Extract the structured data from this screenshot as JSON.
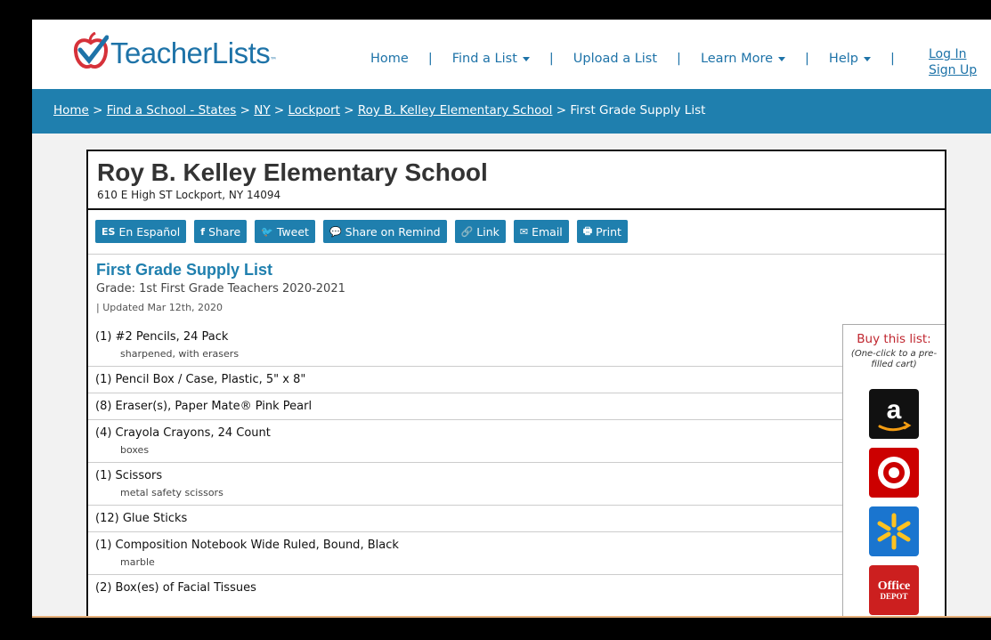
{
  "header": {
    "logo_text": "TeacherLists",
    "logo_tm": "™",
    "nav": [
      {
        "label": "Home",
        "caret": false
      },
      {
        "label": "Find a List",
        "caret": true
      },
      {
        "label": "Upload a List",
        "caret": false
      },
      {
        "label": "Learn More",
        "caret": true
      },
      {
        "label": "Help",
        "caret": true
      }
    ],
    "login": "Log In",
    "signup": "Sign Up"
  },
  "breadcrumb": {
    "items": [
      "Home",
      "Find a School - States",
      "NY",
      "Lockport",
      "Roy B. Kelley Elementary School"
    ],
    "separator": ">",
    "current": "First Grade Supply List"
  },
  "school": {
    "name": "Roy B. Kelley Elementary School",
    "address": "610 E High ST Lockport, NY 14094"
  },
  "actions": [
    {
      "icon": "ES",
      "label": "En Español",
      "name": "espanol-button"
    },
    {
      "icon": "f",
      "label": "Share",
      "name": "share-button"
    },
    {
      "icon": "🐦",
      "label": "Tweet",
      "name": "tweet-button"
    },
    {
      "icon": "💬",
      "label": "Share on Remind",
      "name": "remind-button"
    },
    {
      "icon": "🔗",
      "label": "Link",
      "name": "link-button"
    },
    {
      "icon": "✉",
      "label": "Email",
      "name": "email-button"
    },
    {
      "icon": "🖶",
      "label": "Print",
      "name": "print-button"
    }
  ],
  "list": {
    "title": "First Grade Supply List",
    "meta": "Grade: 1st  First Grade Teachers  2020-2021",
    "updated": "| Updated Mar 12th, 2020",
    "items": [
      {
        "name": "(1)  #2 Pencils, 24 Pack",
        "note": "sharpened, with erasers"
      },
      {
        "name": "(1)  Pencil Box / Case, Plastic, 5\" x 8\"",
        "note": ""
      },
      {
        "name": "(8)  Eraser(s), Paper Mate® Pink Pearl",
        "note": ""
      },
      {
        "name": "(4)  Crayola Crayons, 24 Count",
        "note": "boxes"
      },
      {
        "name": "(1)  Scissors",
        "note": "metal safety scissors"
      },
      {
        "name": "(12) Glue Sticks",
        "note": ""
      },
      {
        "name": "(1)  Composition Notebook Wide Ruled, Bound, Black",
        "note": "marble"
      },
      {
        "name": "(2)  Box(es) of Facial Tissues",
        "note": ""
      }
    ]
  },
  "buy": {
    "title": "Buy this list:",
    "subtitle": "(One-click to a pre-filled cart)",
    "stores": [
      {
        "name": "amazon",
        "glyph": "a"
      },
      {
        "name": "target",
        "glyph": ""
      },
      {
        "name": "walmart",
        "glyph": ""
      },
      {
        "name": "office-depot",
        "glyph": "Office DEPOT"
      }
    ]
  },
  "colors": {
    "brand_blue": "#1f7fae",
    "accent_red": "#c0262f"
  }
}
